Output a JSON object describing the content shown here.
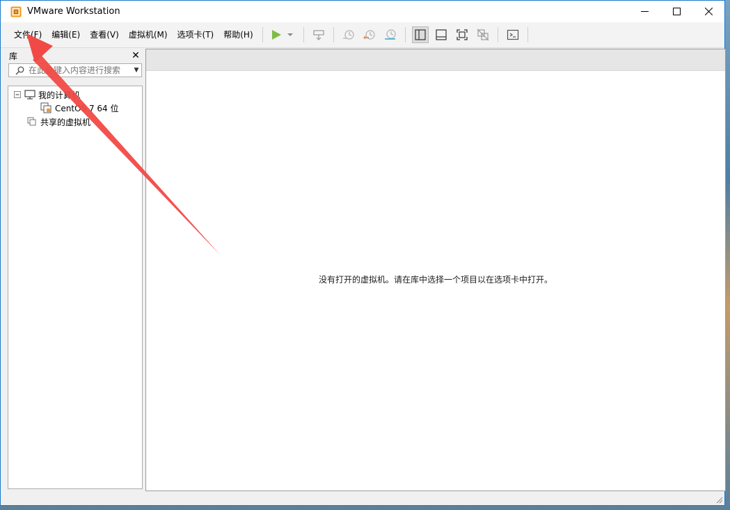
{
  "window": {
    "title": "VMware Workstation"
  },
  "menu": [
    {
      "label": "文件(F)"
    },
    {
      "label": "编辑(E)"
    },
    {
      "label": "查看(V)"
    },
    {
      "label": "虚拟机(M)"
    },
    {
      "label": "选项卡(T)"
    },
    {
      "label": "帮助(H)"
    }
  ],
  "library": {
    "title": "库",
    "search_placeholder": "在此处键入内容进行搜索",
    "tree": [
      {
        "label": "我的计算机"
      },
      {
        "label": "CentOS 7 64 位"
      },
      {
        "label": "共享的虚拟机"
      }
    ]
  },
  "main": {
    "empty_message": "没有打开的虚拟机。请在库中选择一个项目以在选项卡中打开。"
  },
  "colors": {
    "accent": "#1979ca",
    "play": "#7ebd43",
    "annotation": "#f14a46"
  }
}
